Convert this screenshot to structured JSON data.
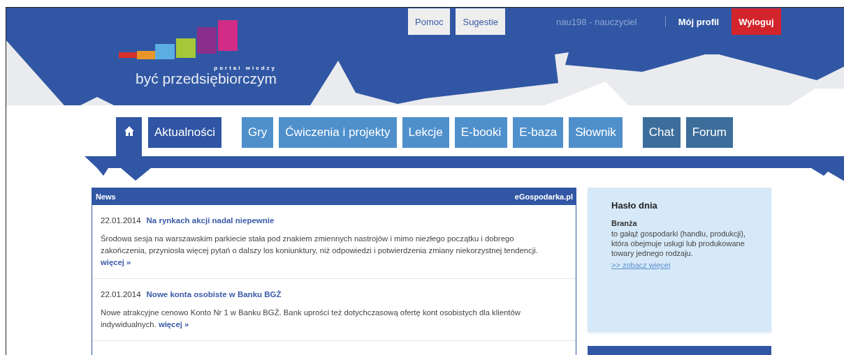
{
  "top_links": [
    {
      "label": "Pomoc",
      "kind": "light"
    },
    {
      "label": "Sugestie",
      "kind": "light"
    }
  ],
  "user": "nau198 - nauczyciel",
  "account_links": [
    {
      "label": "Mój profil",
      "kind": "link"
    },
    {
      "label": "Wyloguj",
      "kind": "alert"
    }
  ],
  "logo": {
    "tagline": "portal wiedzy",
    "name": "być przedsiębiorczym"
  },
  "nav": [
    {
      "kind": "home",
      "selected": true
    },
    {
      "kind": "primary",
      "label": "Aktualności",
      "selected": false
    },
    {
      "kind": "section",
      "label": "Gry",
      "selected": false
    },
    {
      "kind": "section",
      "label": "Ćwiczenia i projekty",
      "selected": false
    },
    {
      "kind": "section",
      "label": "Lekcje",
      "selected": false
    },
    {
      "kind": "section",
      "label": "E-booki",
      "selected": false
    },
    {
      "kind": "section",
      "label": "E-baza",
      "selected": false
    },
    {
      "kind": "section",
      "label": "Słownik",
      "selected": false
    },
    {
      "kind": "community",
      "label": "Chat",
      "selected": false
    },
    {
      "kind": "community",
      "label": "Forum",
      "selected": false
    }
  ],
  "news": {
    "title": "News",
    "source": "eGospodarka.pl",
    "items": [
      {
        "date": "22.01.2014",
        "title": "Na rynkach akcji nadal niepewnie",
        "text": "Środowa sesja na warszawskim parkiecie stała pod znakiem zmiennych nastrojów i mimo niezłego początku i dobrego zakończenia, przyniosła więcej pytań o dalszy los koniunktury, niż odpowiedzi i potwierdzenia zmiany niekorzystnej tendencji.",
        "more": "więcej »"
      },
      {
        "date": "22.01.2014",
        "title": "Nowe konta osobiste w Banku BGŻ",
        "text": "Nowe atrakcyjne cenowo Konto Nr 1 w Banku BGŻ. Bank uprości też dotychczasową ofertę kont osobistych dla klientów indywidualnych.",
        "more": "więcej »"
      }
    ]
  },
  "word_of_day": {
    "title": "Hasło dnia",
    "term": "Branża",
    "definition": "to gałąź gospodarki (handlu, produkcji), która obejmuje usługi lub produkowane towary jednego rodzaju.",
    "link": ">> zobacz więcej"
  }
}
